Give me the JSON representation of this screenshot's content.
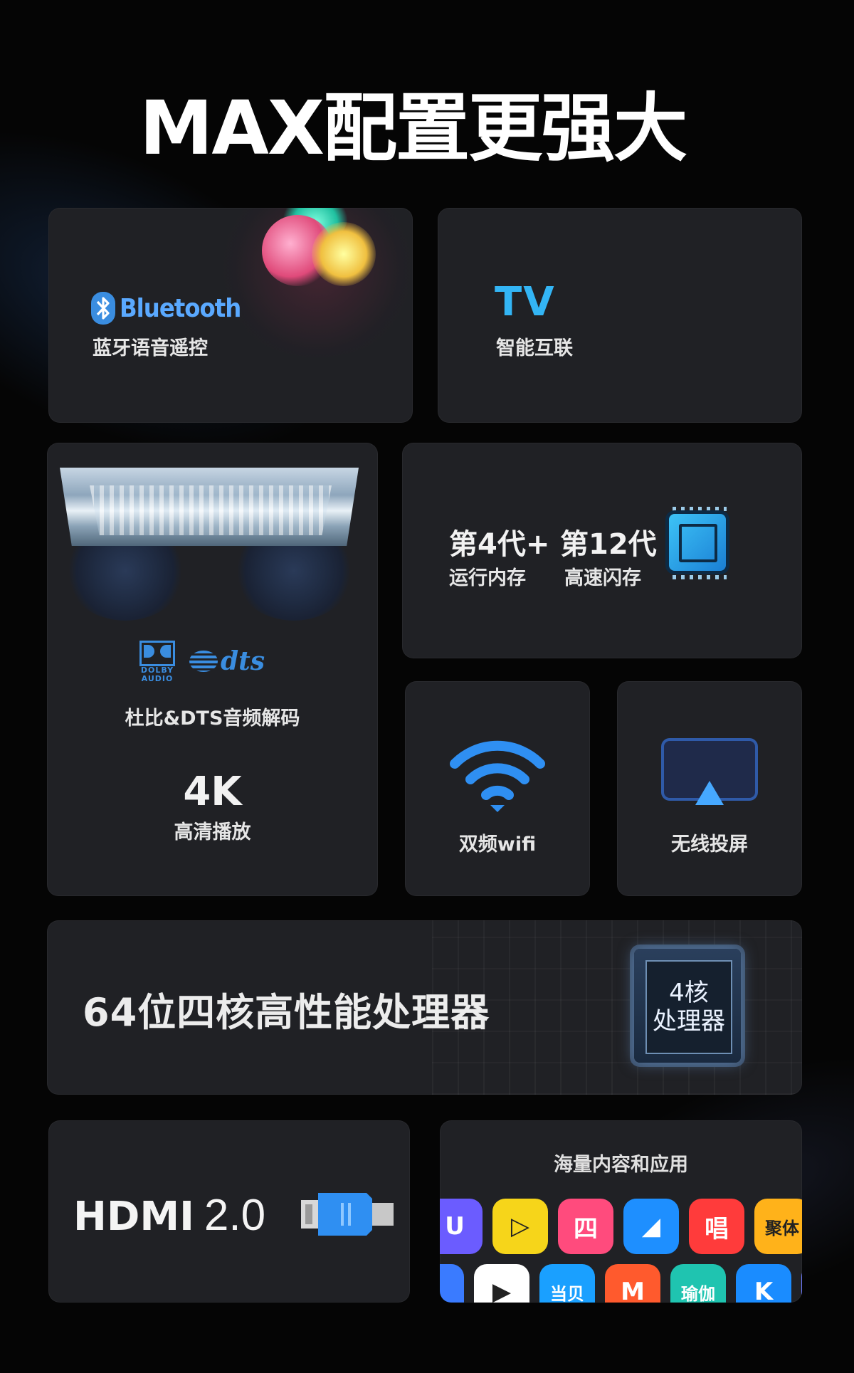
{
  "title": "MAX配置更强大",
  "cards": {
    "bluetooth": {
      "brand": "Bluetooth",
      "label": "蓝牙语音遥控"
    },
    "tv": {
      "brand": "TV",
      "label": "智能互联"
    },
    "audio": {
      "dolby_line1": "DOLBY",
      "dolby_line2": "AUDIO",
      "dts": "dts",
      "label": "杜比&DTS音频解码",
      "res": "4K",
      "res_label": "高清播放"
    },
    "memory": {
      "ram_title": "第4代+",
      "ram_label": "运行内存",
      "rom_title": "第12代",
      "rom_label": "高速闪存",
      "chip_icon": "chip-icon"
    },
    "wifi": {
      "label": "双频wifi",
      "icon": "wifi-icon"
    },
    "cast": {
      "label": "无线投屏",
      "icon": "screencast-icon"
    },
    "processor": {
      "title": "64位四核高性能处理器",
      "chip_line1": "4核",
      "chip_line2": "处理器"
    },
    "hdmi": {
      "name": "HDMI",
      "version": "2.0",
      "icon": "hdmi-plug-icon"
    },
    "apps": {
      "label": "海量内容和应用",
      "row1": [
        {
          "text": "U",
          "color": "#6b5cff"
        },
        {
          "text": "▷",
          "color": "#f6d51a"
        },
        {
          "text": "四",
          "color": "#ff4b7d"
        },
        {
          "text": "◢",
          "color": "#1e8fff"
        },
        {
          "text": "唱",
          "color": "#ff3b3b"
        },
        {
          "text": "聚体",
          "color": "#ffb21a"
        }
      ],
      "row2": [
        {
          "text": "",
          "color": "#3a7bff"
        },
        {
          "text": "▶",
          "color": "#ffffff"
        },
        {
          "text": "当贝",
          "color": "#1aa0ff"
        },
        {
          "text": "M",
          "color": "#ff5a2d"
        },
        {
          "text": "瑜伽",
          "color": "#1fc4b0"
        },
        {
          "text": "K",
          "color": "#1a8cff"
        },
        {
          "text": "",
          "color": "#6f7cff"
        }
      ]
    }
  }
}
